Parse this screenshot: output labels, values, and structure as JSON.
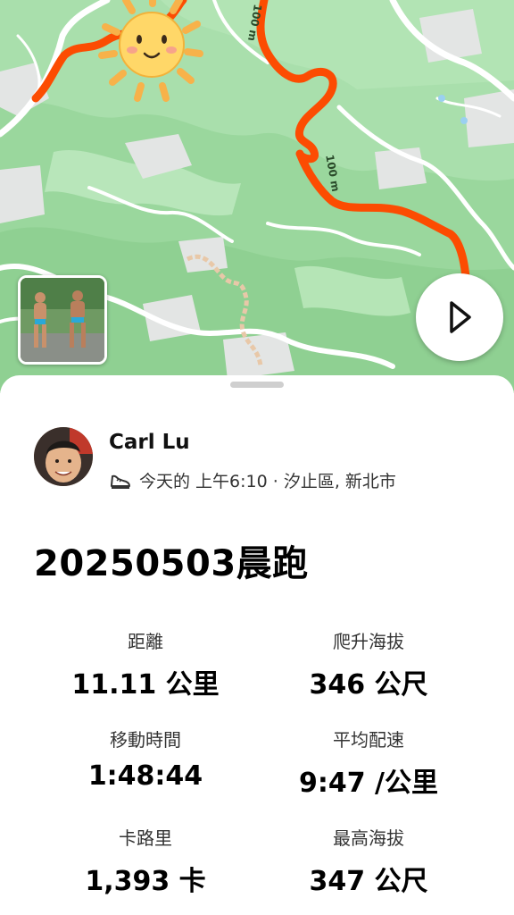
{
  "map": {
    "route_color": "#fc4c02",
    "distance_markers": [
      "100 m",
      "100 m"
    ]
  },
  "controls": {
    "play_icon": "play-icon"
  },
  "activity": {
    "athlete_name": "Carl Lu",
    "meta": "今天的 上午6:10 · 汐止區, 新北市",
    "title": "20250503晨跑"
  },
  "stats": [
    {
      "label": "距離",
      "value": "11.11 公里"
    },
    {
      "label": "爬升海拔",
      "value": "346 公尺"
    },
    {
      "label": "移動時間",
      "value": "1:48:44"
    },
    {
      "label": "平均配速",
      "value": "9:47 /公里"
    },
    {
      "label": "卡路里",
      "value": "1,393 卡"
    },
    {
      "label": "最高海拔",
      "value": "347 公尺"
    }
  ]
}
